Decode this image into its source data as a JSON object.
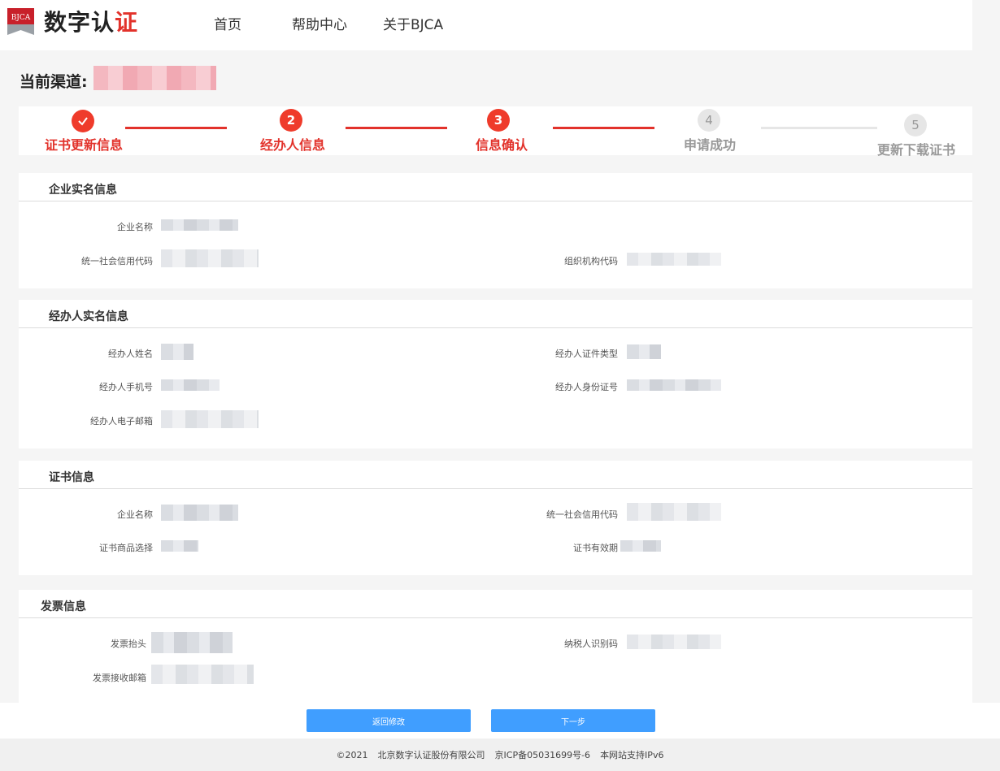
{
  "header": {
    "logo_badge": "BJCA",
    "logo_text_a": "数字认",
    "logo_text_b": "证",
    "nav": [
      "首页",
      "帮助中心",
      "关于BJCA"
    ]
  },
  "channel": {
    "label": "当前渠道:"
  },
  "steps": [
    {
      "index": "✓",
      "label": "证书更新信息",
      "state": "active"
    },
    {
      "index": "2",
      "label": "经办人信息",
      "state": "active"
    },
    {
      "index": "3",
      "label": "信息确认",
      "state": "active"
    },
    {
      "index": "4",
      "label": "申请成功",
      "state": "pending"
    },
    {
      "index": "5",
      "label": "更新下载证书",
      "state": "pending"
    }
  ],
  "sections": {
    "enterprise": {
      "title": "企业实名信息",
      "fields": {
        "name": "企业名称",
        "credit_code": "统一社会信用代码",
        "org_code": "组织机构代码"
      }
    },
    "agent": {
      "title": "经办人实名信息",
      "fields": {
        "name": "经办人姓名",
        "id_type": "经办人证件类型",
        "phone": "经办人手机号",
        "id_number": "经办人身份证号",
        "email": "经办人电子邮箱"
      }
    },
    "cert": {
      "title": "证书信息",
      "fields": {
        "name": "企业名称",
        "credit_code": "统一社会信用代码",
        "product": "证书商品选择",
        "validity": "证书有效期"
      }
    },
    "invoice": {
      "title": "发票信息",
      "fields": {
        "header": "发票抬头",
        "tax_id": "纳税人识别码",
        "email": "发票接收邮箱"
      }
    }
  },
  "buttons": {
    "back": "返回修改",
    "next": "下一步"
  },
  "footer": {
    "copyright": "©2021",
    "company": "北京数字认证股份有限公司",
    "icp": "京ICP备05031699号-6",
    "ipv6": "本网站支持IPv6"
  },
  "colors": {
    "accent": "#e2322b",
    "button": "#409eff"
  }
}
